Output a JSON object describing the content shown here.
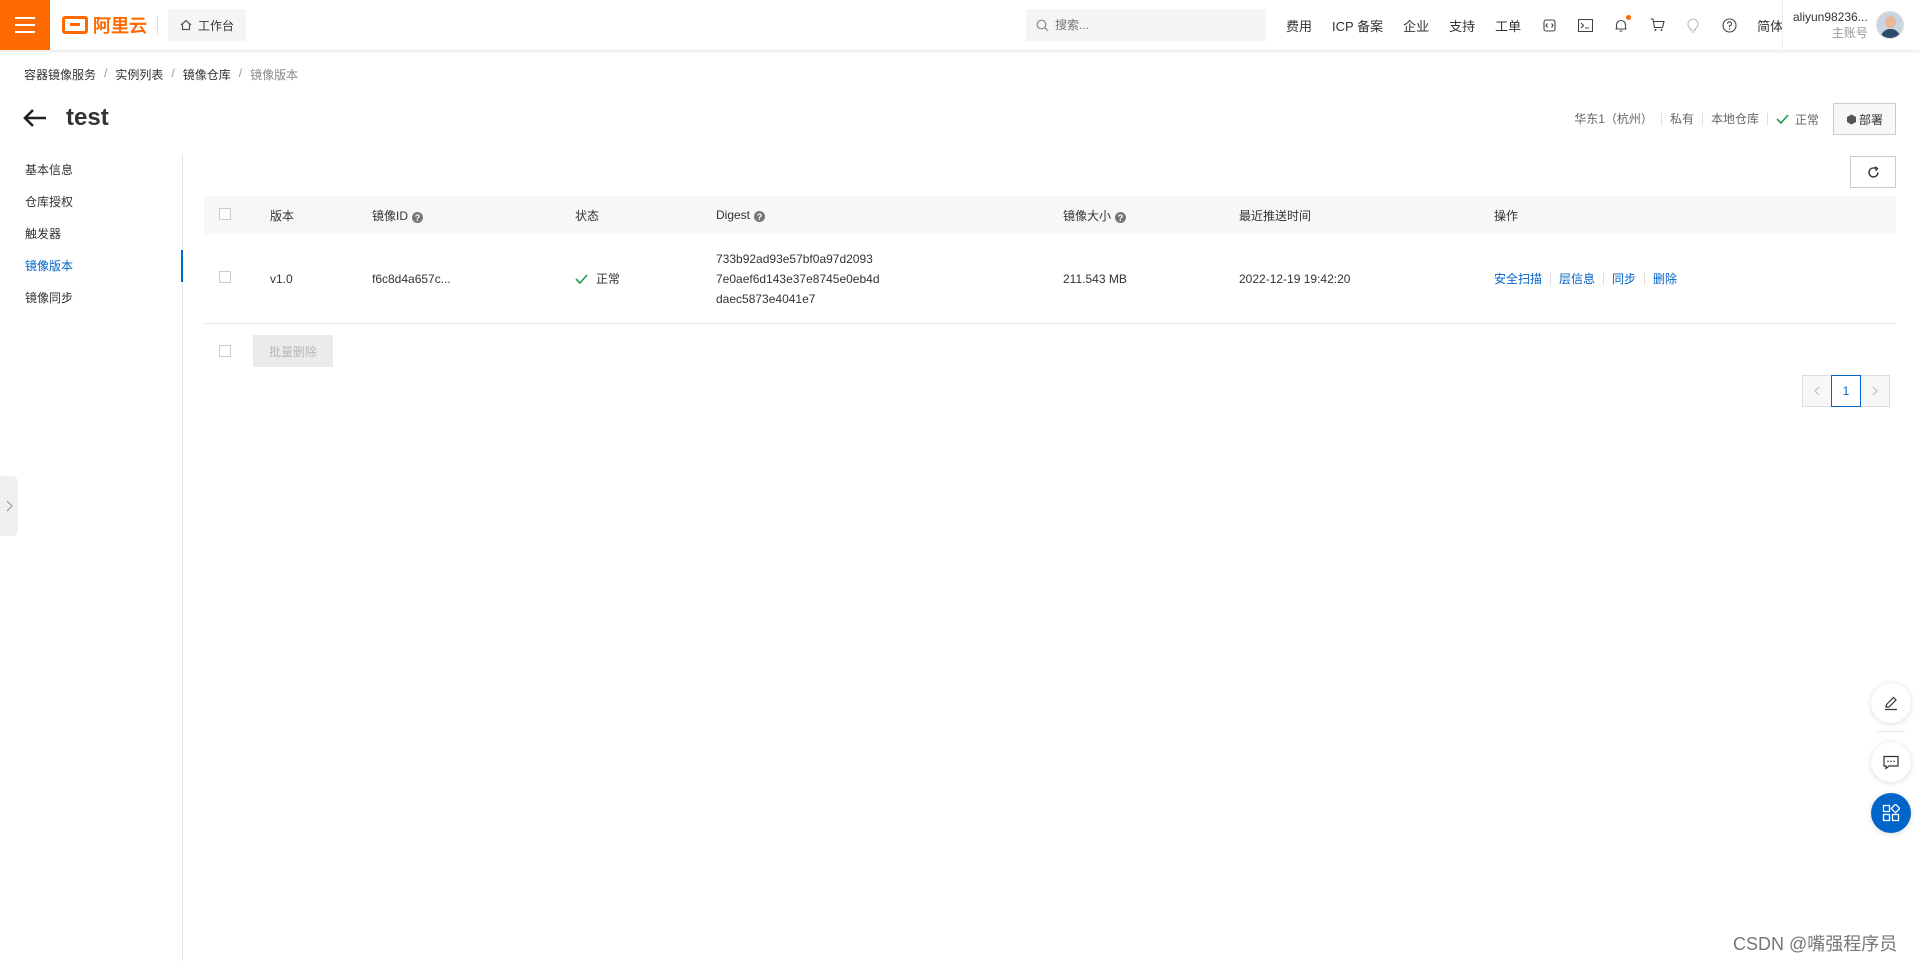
{
  "topbar": {
    "logo_text": "阿里云",
    "workbench_label": "工作台",
    "search_placeholder": "搜索...",
    "links": [
      "费用",
      "ICP 备案",
      "企业",
      "支持",
      "工单"
    ],
    "lang_label": "简体",
    "account_name": "aliyun98236...",
    "account_role": "主账号"
  },
  "breadcrumb": {
    "items": [
      "容器镜像服务",
      "实例列表",
      "镜像仓库"
    ],
    "current": "镜像版本"
  },
  "page": {
    "title": "test",
    "meta": [
      "华东1（杭州）",
      "私有",
      "本地仓库"
    ],
    "status": "正常",
    "deploy_label": "部署"
  },
  "sidebar": {
    "items": [
      {
        "label": "基本信息",
        "active": false
      },
      {
        "label": "仓库授权",
        "active": false
      },
      {
        "label": "触发器",
        "active": false
      },
      {
        "label": "镜像版本",
        "active": true
      },
      {
        "label": "镜像同步",
        "active": false
      }
    ]
  },
  "table": {
    "headers": {
      "version": "版本",
      "image_id": "镜像ID",
      "state": "状态",
      "digest": "Digest",
      "size": "镜像大小",
      "pushed": "最近推送时间",
      "ops": "操作"
    },
    "rows": [
      {
        "version": "v1.0",
        "image_id": "f6c8d4a657c...",
        "state": "正常",
        "digest_lines": [
          "733b92ad93e57bf0a97d2093",
          "7e0aef6d143e37e8745e0eb4d",
          "daec5873e4041e7"
        ],
        "size": "211.543 MB",
        "pushed": "2022-12-19 19:42:20",
        "ops": [
          "安全扫描",
          "层信息",
          "同步",
          "删除"
        ]
      }
    ],
    "batch_delete_label": "批量删除"
  },
  "pagination": {
    "current": "1"
  },
  "watermark": "CSDN @嘴强程序员",
  "colors": {
    "brand": "#ff6a00",
    "link": "#0064c8",
    "success": "#1f9d55"
  }
}
